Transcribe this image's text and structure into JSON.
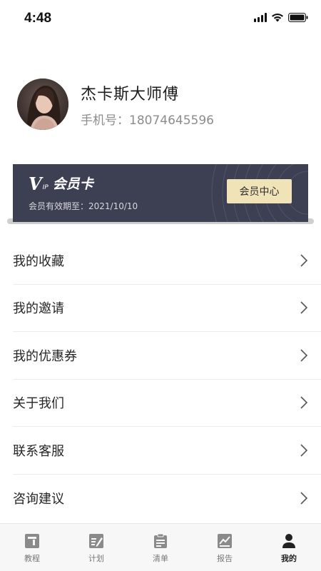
{
  "status_bar": {
    "time": "4:48"
  },
  "profile": {
    "name": "杰卡斯大师傅",
    "phone_label": "手机号：18074645596"
  },
  "vip_card": {
    "brand_v": "V",
    "brand_ip": "IP",
    "title": "会员卡",
    "expiry": "会员有效期至：2021/10/10",
    "center_button": "会员中心"
  },
  "menu": {
    "items": [
      {
        "label": "我的收藏"
      },
      {
        "label": "我的邀请"
      },
      {
        "label": "我的优惠券"
      },
      {
        "label": "关于我们"
      },
      {
        "label": "联系客服"
      },
      {
        "label": "咨询建议"
      }
    ]
  },
  "tabbar": {
    "tabs": [
      {
        "label": "教程",
        "icon": "tutorial-icon"
      },
      {
        "label": "计划",
        "icon": "plan-icon"
      },
      {
        "label": "清单",
        "icon": "list-icon"
      },
      {
        "label": "报告",
        "icon": "report-icon"
      },
      {
        "label": "我的",
        "icon": "profile-icon"
      }
    ],
    "active_index": 4
  },
  "colors": {
    "vip_bg": "#3d3f52",
    "vip_button": "#f1e3b8",
    "active_tab": "#222222",
    "inactive_tab": "#777777"
  }
}
